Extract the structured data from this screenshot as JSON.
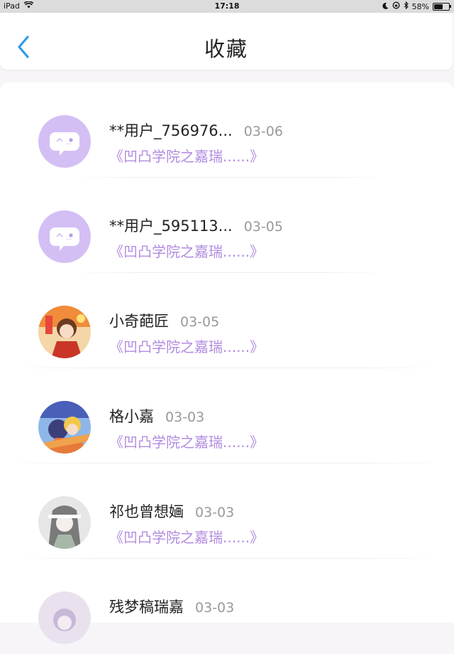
{
  "status_bar": {
    "device": "iPad",
    "time": "17:18",
    "battery": "58%",
    "battery_level": 0.58
  },
  "header": {
    "title": "收藏",
    "back_icon": "chevron-left-icon",
    "accent_color": "#2f9be8"
  },
  "favorites": [
    {
      "user": "**用户_756976...",
      "date": "03-06",
      "work": "《凹凸学院之嘉瑞......》",
      "avatar": "default-chat-icon"
    },
    {
      "user": "**用户_595113...",
      "date": "03-05",
      "work": "《凹凸学院之嘉瑞......》",
      "avatar": "default-chat-icon"
    },
    {
      "user": "小奇葩匠",
      "date": "03-05",
      "work": "《凹凸学院之嘉瑞......》",
      "avatar": "user-photo"
    },
    {
      "user": "格小嘉",
      "date": "03-03",
      "work": "《凹凸学院之嘉瑞......》",
      "avatar": "user-photo"
    },
    {
      "user": "祁也曾想婳",
      "date": "03-03",
      "work": "《凹凸学院之嘉瑞......》",
      "avatar": "user-photo"
    },
    {
      "user": "残梦稿瑞嘉",
      "date": "03-03",
      "work": "",
      "avatar": "user-photo"
    }
  ],
  "colors": {
    "work_title": "#b28be0",
    "default_avatar_bg": "#d4bff5"
  }
}
